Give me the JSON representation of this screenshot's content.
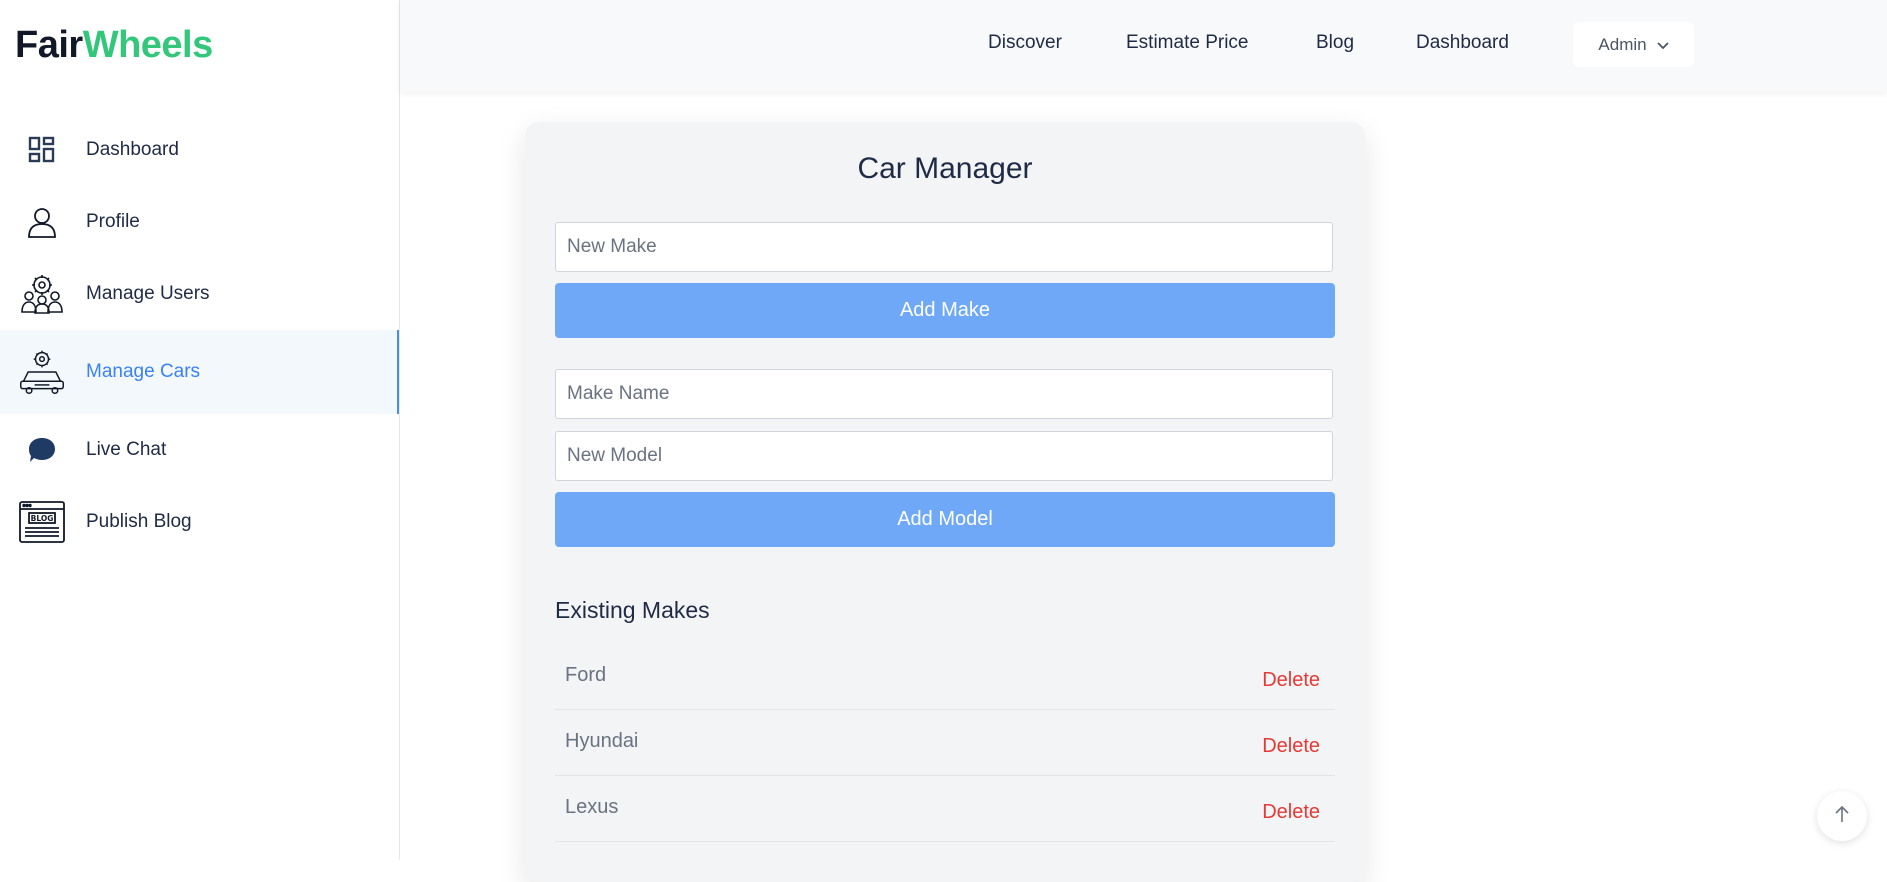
{
  "brand": {
    "part1": "Fair",
    "part2": "Wheels"
  },
  "sidebar": {
    "items": [
      {
        "label": "Dashboard",
        "icon": "dashboard-icon"
      },
      {
        "label": "Profile",
        "icon": "user-icon"
      },
      {
        "label": "Manage Users",
        "icon": "users-gear-icon"
      },
      {
        "label": "Manage Cars",
        "icon": "car-gear-icon",
        "active": true
      },
      {
        "label": "Live Chat",
        "icon": "chat-bubble-icon"
      },
      {
        "label": "Publish Blog",
        "icon": "blog-icon"
      }
    ]
  },
  "header": {
    "links": [
      "Discover",
      "Estimate Price",
      "Blog",
      "Dashboard"
    ],
    "user_menu": "Admin"
  },
  "card": {
    "title": "Car Manager",
    "new_make_placeholder": "New Make",
    "add_make_label": "Add Make",
    "make_name_placeholder": "Make Name",
    "new_model_placeholder": "New Model",
    "add_model_label": "Add Model",
    "existing_title": "Existing Makes",
    "makes": [
      {
        "name": "Ford",
        "action": "Delete"
      },
      {
        "name": "Hyundai",
        "action": "Delete"
      },
      {
        "name": "Lexus",
        "action": "Delete"
      }
    ]
  },
  "colors": {
    "brand_green": "#34c77b",
    "primary_button": "#6ea8f7",
    "active_nav": "#3b82f6",
    "delete_red": "#e53935"
  }
}
